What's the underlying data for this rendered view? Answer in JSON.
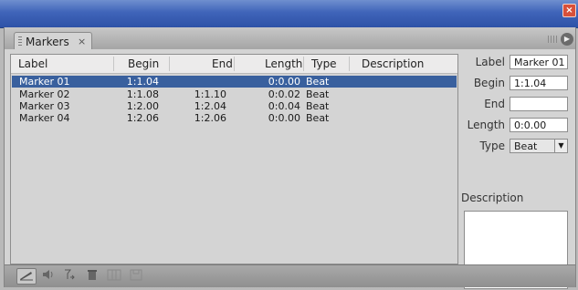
{
  "window": {
    "close_glyph": "×"
  },
  "panel": {
    "tab_label": "Markers",
    "tab_close": "×",
    "menu_glyph": "▶"
  },
  "columns": {
    "label": "Label",
    "begin": "Begin",
    "end": "End",
    "length": "Length",
    "type": "Type",
    "description": "Description"
  },
  "markers": [
    {
      "label": "Marker 01",
      "begin": "1:1.04",
      "end": "",
      "length": "0:0.00",
      "type": "Beat",
      "description": ""
    },
    {
      "label": "Marker 02",
      "begin": "1:1.08",
      "end": "1:1.10",
      "length": "0:0.02",
      "type": "Beat",
      "description": ""
    },
    {
      "label": "Marker 03",
      "begin": "1:2.00",
      "end": "1:2.04",
      "length": "0:0.04",
      "type": "Beat",
      "description": ""
    },
    {
      "label": "Marker 04",
      "begin": "1:2.06",
      "end": "1:2.06",
      "length": "0:0.00",
      "type": "Beat",
      "description": ""
    }
  ],
  "selected_index": 0,
  "properties": {
    "label_caption": "Label",
    "label_value": "Marker 01",
    "begin_caption": "Begin",
    "begin_value": "1:1.04",
    "end_caption": "End",
    "end_value": "",
    "length_caption": "Length",
    "length_value": "0:0.00",
    "type_caption": "Type",
    "type_value": "Beat",
    "description_caption": "Description",
    "description_value": ""
  },
  "toolbar_icons": [
    "edit-marker-icon",
    "speaker-icon",
    "merge-icon",
    "delete-icon",
    "column-icon",
    "save-icon"
  ],
  "colors": {
    "selection": "#39609e",
    "titlebar": "#3f64b9",
    "close": "#d8503a"
  }
}
